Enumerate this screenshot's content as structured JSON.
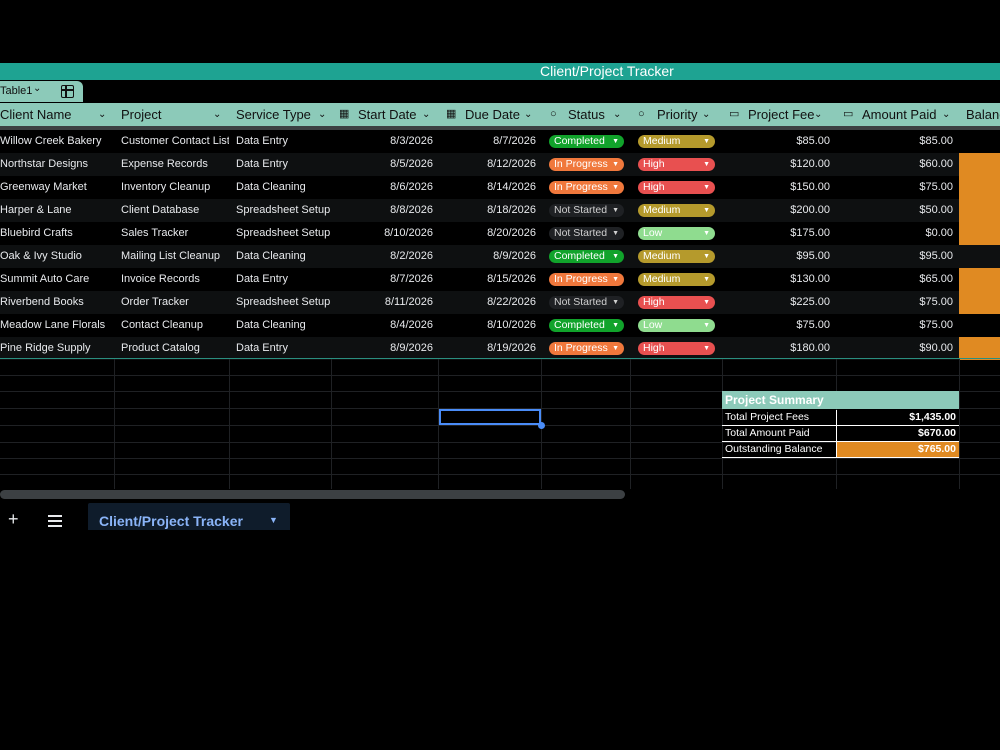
{
  "app": {
    "title": "Client/Project Tracker"
  },
  "table": {
    "name": "Table1"
  },
  "columns": [
    {
      "label": "Client Name"
    },
    {
      "label": "Project"
    },
    {
      "label": "Service Type"
    },
    {
      "label": "Start Date"
    },
    {
      "label": "Due Date"
    },
    {
      "label": "Status"
    },
    {
      "label": "Priority"
    },
    {
      "label": "Project Fee"
    },
    {
      "label": "Amount Paid"
    },
    {
      "label": "Balance"
    }
  ],
  "rows": [
    {
      "client": "Willow Creek Bakery",
      "project": "Customer Contact List",
      "service": "Data Entry",
      "start": "8/3/2026",
      "due": "8/7/2026",
      "status": "Completed",
      "priority": "Medium",
      "fee": "$85.00",
      "paid": "$85.00",
      "balance_due": false
    },
    {
      "client": "Northstar Designs",
      "project": "Expense Records",
      "service": "Data Entry",
      "start": "8/5/2026",
      "due": "8/12/2026",
      "status": "In Progress",
      "priority": "High",
      "fee": "$120.00",
      "paid": "$60.00",
      "balance_due": true
    },
    {
      "client": "Greenway Market",
      "project": "Inventory Cleanup",
      "service": "Data Cleaning",
      "start": "8/6/2026",
      "due": "8/14/2026",
      "status": "In Progress",
      "priority": "High",
      "fee": "$150.00",
      "paid": "$75.00",
      "balance_due": true
    },
    {
      "client": "Harper & Lane",
      "project": "Client Database",
      "service": "Spreadsheet Setup",
      "start": "8/8/2026",
      "due": "8/18/2026",
      "status": "Not Started",
      "priority": "Medium",
      "fee": "$200.00",
      "paid": "$50.00",
      "balance_due": true
    },
    {
      "client": "Bluebird Crafts",
      "project": "Sales Tracker",
      "service": "Spreadsheet Setup",
      "start": "8/10/2026",
      "due": "8/20/2026",
      "status": "Not Started",
      "priority": "Low",
      "fee": "$175.00",
      "paid": "$0.00",
      "balance_due": true
    },
    {
      "client": "Oak & Ivy Studio",
      "project": "Mailing List Cleanup",
      "service": "Data Cleaning",
      "start": "8/2/2026",
      "due": "8/9/2026",
      "status": "Completed",
      "priority": "Medium",
      "fee": "$95.00",
      "paid": "$95.00",
      "balance_due": false
    },
    {
      "client": "Summit Auto Care",
      "project": "Invoice Records",
      "service": "Data Entry",
      "start": "8/7/2026",
      "due": "8/15/2026",
      "status": "In Progress",
      "priority": "Medium",
      "fee": "$130.00",
      "paid": "$65.00",
      "balance_due": true
    },
    {
      "client": "Riverbend Books",
      "project": "Order Tracker",
      "service": "Spreadsheet Setup",
      "start": "8/11/2026",
      "due": "8/22/2026",
      "status": "Not Started",
      "priority": "High",
      "fee": "$225.00",
      "paid": "$75.00",
      "balance_due": true
    },
    {
      "client": "Meadow Lane Florals",
      "project": "Contact Cleanup",
      "service": "Data Cleaning",
      "start": "8/4/2026",
      "due": "8/10/2026",
      "status": "Completed",
      "priority": "Low",
      "fee": "$75.00",
      "paid": "$75.00",
      "balance_due": false
    },
    {
      "client": "Pine Ridge Supply",
      "project": "Product Catalog",
      "service": "Data Entry",
      "start": "8/9/2026",
      "due": "8/19/2026",
      "status": "In Progress",
      "priority": "High",
      "fee": "$180.00",
      "paid": "$90.00",
      "balance_due": true
    }
  ],
  "status_colors": {
    "Completed": {
      "bg": "#11a32b",
      "fg": "#ffffff"
    },
    "In Progress": {
      "bg": "#f0783c",
      "fg": "#ffffff"
    },
    "Not Started": {
      "bg": "#1f2124",
      "fg": "#d0d0d0"
    }
  },
  "priority_colors": {
    "Medium": {
      "bg": "#b59a2c",
      "fg": "#ffffff"
    },
    "High": {
      "bg": "#e85050",
      "fg": "#ffffff"
    },
    "Low": {
      "bg": "#8fdc8f",
      "fg": "#ffffff"
    }
  },
  "balance_color": "#e08a22",
  "summary": {
    "title": "Project Summary",
    "rows": [
      {
        "label": "Total Project Fees",
        "value": "$1,435.00",
        "highlight": false
      },
      {
        "label": "Total Amount Paid",
        "value": "$670.00",
        "highlight": false
      },
      {
        "label": "Outstanding Balance",
        "value": "$765.00",
        "highlight": true
      }
    ]
  },
  "sheet_tab": {
    "name": "Client/Project Tracker"
  },
  "icons": {
    "add_sheet": "plus-icon",
    "all_sheets": "menu-icon",
    "date": "calendar-icon",
    "chip": "dropdown-chip-icon",
    "money": "currency-icon"
  }
}
